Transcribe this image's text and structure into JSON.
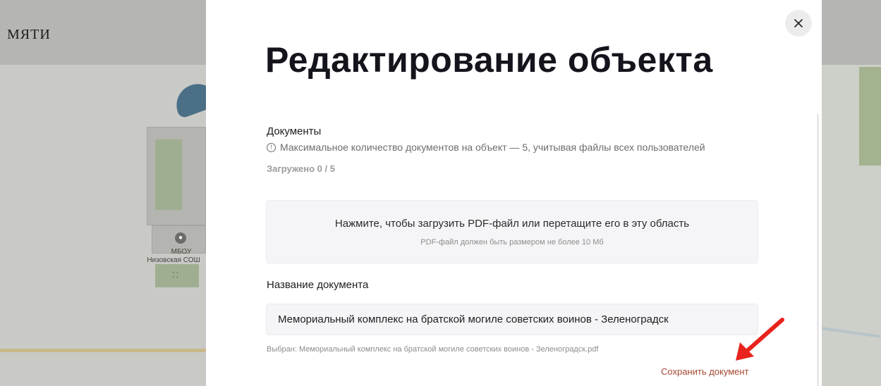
{
  "background": {
    "site_title": "МЯТИ",
    "map_poi_name": "МБОУ",
    "map_poi_name_2": "Низовская СОШ",
    "map_poi_symbol": "⛶"
  },
  "modal": {
    "title": "Редактирование объекта",
    "close_icon": "close-icon",
    "documents": {
      "label": "Документы",
      "hint": "Максимальное количество документов на объект — 5, учитывая файлы всех пользователей",
      "uploaded_count": "Загружено 0 / 5"
    },
    "dropzone": {
      "main_text": "Нажмите, чтобы загрузить PDF-файл или перетащите его в эту область",
      "sub_text": "PDF-файл должен быть размером не более 10 Мб"
    },
    "document_name": {
      "label": "Название документа",
      "value": "Мемориальный комплекс на братской могиле советских воинов - Зеленоградск"
    },
    "selected_file": "Выбран: Мемориальный комплекс на братской могиле советских воинов - Зеленоградск.pdf",
    "save_label": "Сохранить документ"
  },
  "colors": {
    "save_link": "#a3472f",
    "annotation_arrow": "#e8231d",
    "title": "#14141c"
  }
}
